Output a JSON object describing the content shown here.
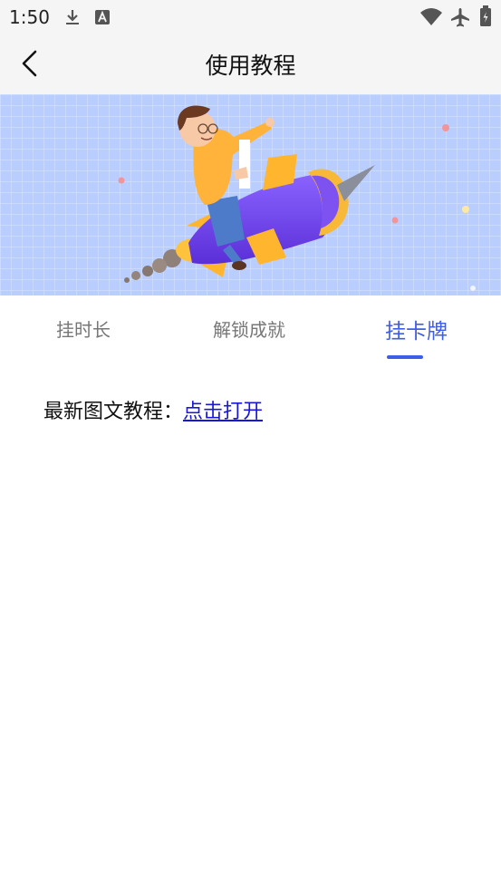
{
  "status_bar": {
    "time": "1:50",
    "left_icons": [
      "download-icon",
      "a-square-icon"
    ],
    "right_icons": [
      "wifi-icon",
      "airplane-icon",
      "battery-icon"
    ]
  },
  "app_bar": {
    "back_icon": "chevron-left-icon",
    "title": "使用教程"
  },
  "banner": {
    "image": "boy-riding-purple-rocket-illustration",
    "background_color": "#b9ceff"
  },
  "tabs": [
    {
      "label": "挂时长",
      "active": false
    },
    {
      "label": "解锁成就",
      "active": false
    },
    {
      "label": "挂卡牌",
      "active": true
    }
  ],
  "content": {
    "prefix": "最新图文教程：",
    "link_text": "点击打开"
  },
  "colors": {
    "accent": "#3f5ee6",
    "link": "#1818d6"
  }
}
